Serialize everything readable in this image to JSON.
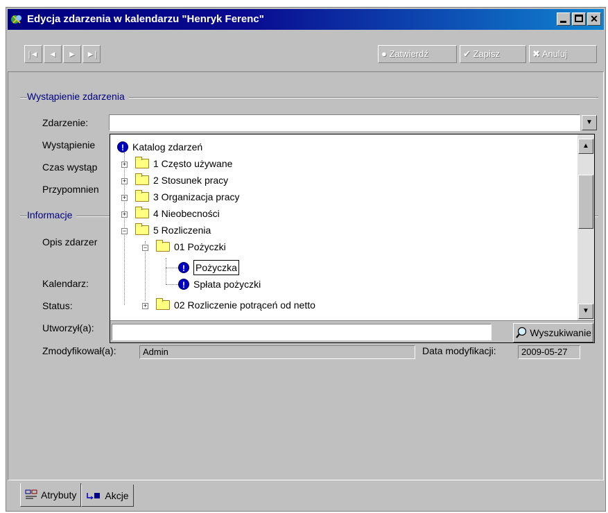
{
  "window": {
    "title": "Edycja zdarzenia w kalendarzu \"Henryk Ferenc\""
  },
  "toolbar": {
    "nav": [
      "|◄",
      "◄",
      "►",
      "►|"
    ],
    "confirm_label": "Zatwierdź",
    "save_label": "Zapisz",
    "cancel_label": "Anuluj"
  },
  "form": {
    "group_occurrence": "Wystąpienie zdarzenia",
    "event_label": "Zdarzenie:",
    "event_value": "",
    "occurrence_label": "Wystąpienie",
    "time_label": "Czas wystąp",
    "reminder_label": "Przypomnien",
    "group_info": "Informacje",
    "description_label": "Opis zdarzer",
    "calendar_label": "Kalendarz:",
    "status_label": "Status:",
    "created_by_label": "Utworzył(a):",
    "modified_by_label": "Zmodyfikował(a):",
    "modified_by_value": "Admin",
    "modified_date_label": "Data modyfikacji:",
    "modified_date_value": "2009-05-27"
  },
  "dropdown": {
    "tree": [
      {
        "label": "Katalog zdarzeń",
        "icon": "info-icon"
      },
      {
        "label": "1 Często używane",
        "icon": "folder-icon",
        "expander": "+"
      },
      {
        "label": "2 Stosunek pracy",
        "icon": "folder-icon",
        "expander": "+"
      },
      {
        "label": "3 Organizacja pracy",
        "icon": "folder-icon",
        "expander": "+"
      },
      {
        "label": "4 Nieobecności",
        "icon": "folder-icon",
        "expander": "+"
      },
      {
        "label": "5 Rozliczenia",
        "icon": "folder-open-icon",
        "expander": "−"
      },
      {
        "label": "01 Pożyczki",
        "icon": "folder-open-icon",
        "expander": "−"
      },
      {
        "label": "Pożyczka",
        "icon": "info-icon",
        "selected": true
      },
      {
        "label": "Spłata pożyczki",
        "icon": "info-icon"
      },
      {
        "label": "02 Rozliczenie potrąceń od netto",
        "icon": "folder-icon",
        "expander": "+"
      }
    ],
    "search_value": "",
    "search_label": "Wyszukiwanie"
  },
  "tabs": [
    {
      "label": "Atrybuty",
      "icon": "attributes-icon",
      "active": true
    },
    {
      "label": "Akcje",
      "icon": "actions-icon",
      "active": false
    }
  ],
  "colors": {
    "titlebar": "#000080",
    "group_label": "#000080",
    "info_icon": "#0000c0",
    "folder": "#ffff80"
  }
}
